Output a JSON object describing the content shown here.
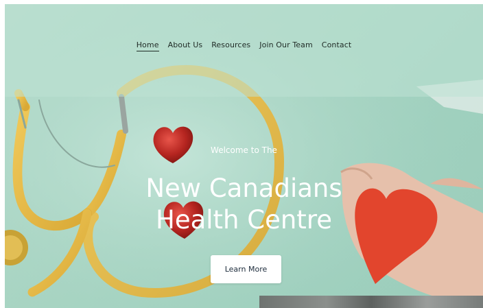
{
  "nav": {
    "items": [
      {
        "label": "Home",
        "active": true
      },
      {
        "label": "About Us",
        "active": false
      },
      {
        "label": "Resources",
        "active": false
      },
      {
        "label": "Join Our Team",
        "active": false
      },
      {
        "label": "Contact",
        "active": false
      }
    ]
  },
  "hero": {
    "kicker": "Welcome to The",
    "headline_line1": "New Canadians",
    "headline_line2": "Health Centre",
    "cta_label": "Learn More"
  },
  "colors": {
    "hero_bg": "#a9d5c3",
    "stethoscope": "#e3b84a",
    "heart_red": "#c9312b",
    "paper_heart": "#e0472f",
    "hand": "#e2bba6",
    "nav_text": "#1f2a25",
    "button_text": "#1b2a3a"
  },
  "icons": {
    "decor": [
      "stethoscope-image",
      "chocolate-heart-image",
      "paper-heart-image",
      "hand-image"
    ]
  }
}
